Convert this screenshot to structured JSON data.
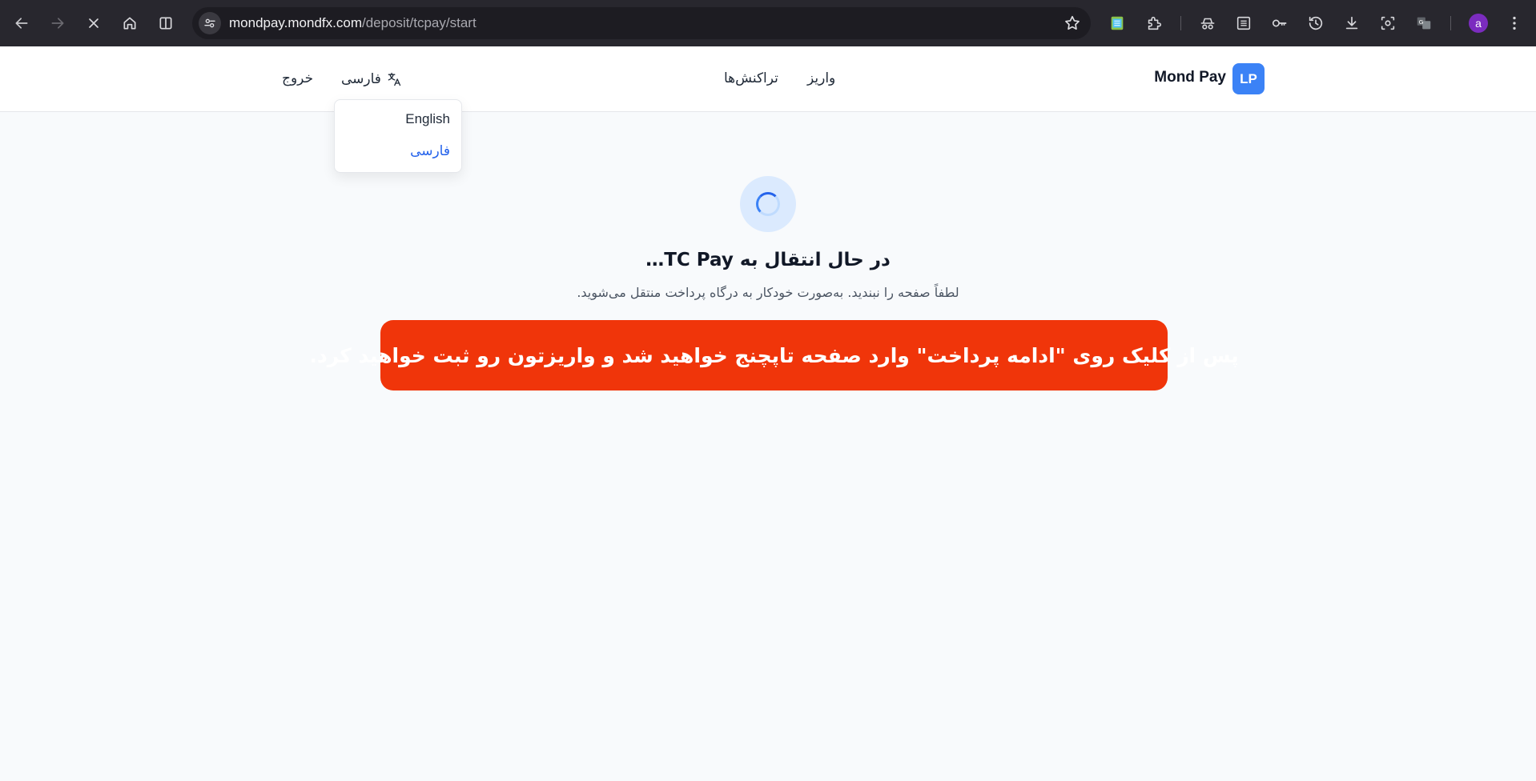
{
  "browser": {
    "url_host": "mondpay.mondfx.com",
    "url_path": "/deposit/tcpay/start",
    "profile_initial": "a",
    "nav_icons": [
      "back-icon",
      "forward-icon",
      "stop-icon",
      "home-icon",
      "split-view-icon"
    ],
    "toolbar_icons": [
      "notes-extension-icon",
      "extensions-icon",
      "incognito-icon",
      "reading-list-icon",
      "passwords-icon",
      "history-icon",
      "downloads-icon",
      "screenshot-icon",
      "translate-icon",
      "menu-icon"
    ]
  },
  "site": {
    "logo_badge": "LP",
    "logo_text": "Mond Pay",
    "nav": {
      "deposit": "واریز",
      "transactions": "تراکنش‌ها",
      "language": "فارسی",
      "logout": "خروج"
    },
    "language_menu": {
      "options": [
        "English",
        "فارسی"
      ],
      "selected": "فارسی"
    }
  },
  "main": {
    "title": "در حال انتقال به TC Pay…",
    "subtitle": "لطفاً صفحه را نبندید. به‌صورت خودکار به درگاه پرداخت منتقل می‌شوید.",
    "banner": "پس از کلیک روی \"ادامه پرداخت\" وارد صفحه تاپچنج خواهید شد و واریزتون رو ثبت خواهید کرد."
  },
  "colors": {
    "accent": "#3b82f6",
    "banner_bg": "#f0350a",
    "selected_lang": "#2563eb"
  }
}
